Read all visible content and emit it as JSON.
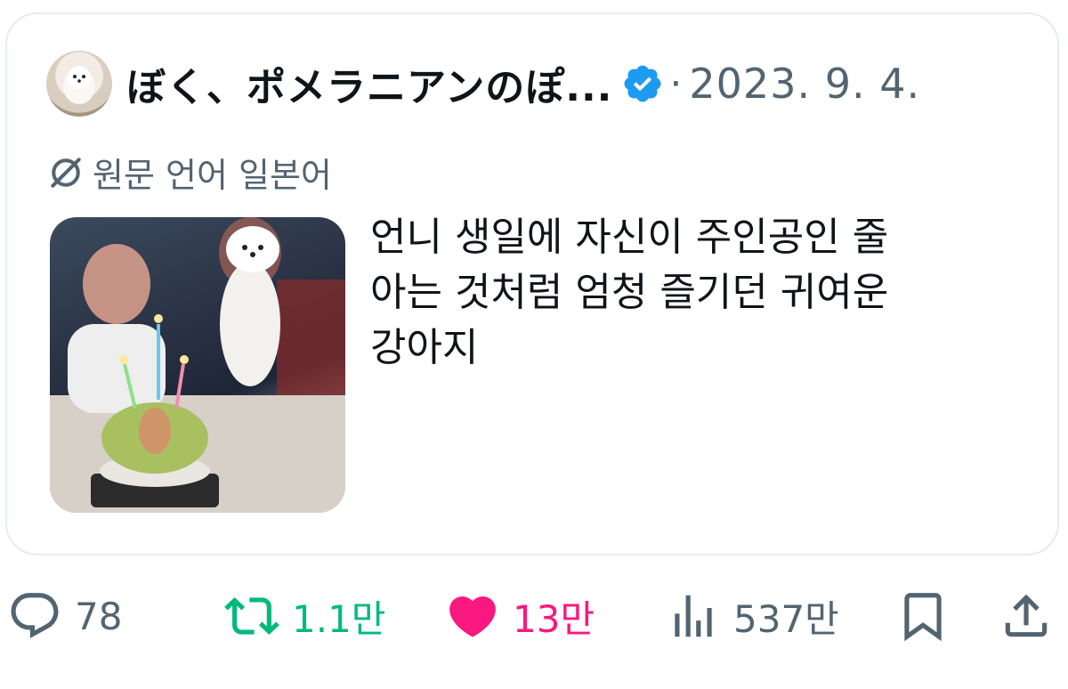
{
  "tweet": {
    "author_name": "ぼく、ポメラニアンのぽ...",
    "separator": "·",
    "date": "2023. 9. 4.",
    "translation_label": "원문 언어 일본어",
    "text": "언니 생일에 자신이 주인공인 줄\n아는 것처럼 엄청 즐기던 귀여운\n강아지"
  },
  "actions": {
    "reply_count": "78",
    "retweet_count": "1.1만",
    "like_count": "13만",
    "views_count": "537만"
  },
  "colors": {
    "text": "#0f1419",
    "secondary": "#536471",
    "verified": "#1d9bf0",
    "retweet": "#00ba7c",
    "like": "#f91880"
  },
  "icons": [
    "reply-icon",
    "retweet-icon",
    "like-icon",
    "views-icon",
    "bookmark-icon",
    "share-icon",
    "verified-badge-icon",
    "translate-icon"
  ]
}
